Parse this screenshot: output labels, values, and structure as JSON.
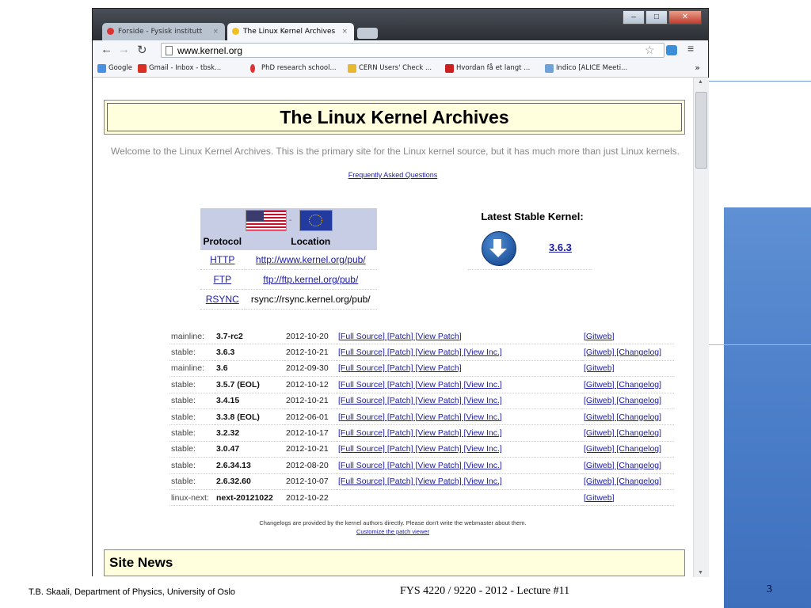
{
  "browser": {
    "tabs": [
      {
        "label": "Forside - Fysisk institutt",
        "active": false
      },
      {
        "label": "The Linux Kernel Archives",
        "active": true
      }
    ],
    "url": "www.kernel.org",
    "bookmarks": [
      "Google",
      "Gmail - Inbox - tbsk...",
      "PhD research school...",
      "CERN Users' Check ...",
      "Hvordan få et langt ...",
      "Indico [ALICE Meeti..."
    ],
    "bookmarks_more": "»"
  },
  "page": {
    "title": "The Linux Kernel Archives",
    "welcome": "Welcome to the Linux Kernel Archives. This is the primary site for the Linux kernel source, but it has much more than just Linux kernels.",
    "faq_link": "Frequently Asked Questions",
    "flag_separator": "-",
    "protocol_table": {
      "headers": [
        "Protocol",
        "Location"
      ],
      "rows": [
        {
          "protocol": "HTTP",
          "location": "http://www.kernel.org/pub/"
        },
        {
          "protocol": "FTP",
          "location": "ftp://ftp.kernel.org/pub/"
        },
        {
          "protocol": "RSYNC",
          "location": "rsync://rsync.kernel.org/pub/"
        }
      ]
    },
    "latest": {
      "title": "Latest Stable Kernel:",
      "version": "3.6.3"
    },
    "releases": [
      {
        "kind": "mainline:",
        "version": "3.7-rc2",
        "date": "2012-10-20",
        "links": "[Full Source] [Patch] [View Patch]",
        "git": "[Gitweb]"
      },
      {
        "kind": "stable:",
        "version": "3.6.3",
        "date": "2012-10-21",
        "links": "[Full Source] [Patch] [View Patch] [View Inc.]",
        "git": "[Gitweb] [Changelog]"
      },
      {
        "kind": "mainline:",
        "version": "3.6",
        "date": "2012-09-30",
        "links": "[Full Source] [Patch] [View Patch]",
        "git": "[Gitweb]"
      },
      {
        "kind": "stable:",
        "version": "3.5.7 (EOL)",
        "date": "2012-10-12",
        "links": "[Full Source] [Patch] [View Patch] [View Inc.]",
        "git": "[Gitweb] [Changelog]"
      },
      {
        "kind": "stable:",
        "version": "3.4.15",
        "date": "2012-10-21",
        "links": "[Full Source] [Patch] [View Patch] [View Inc.]",
        "git": "[Gitweb] [Changelog]"
      },
      {
        "kind": "stable:",
        "version": "3.3.8 (EOL)",
        "date": "2012-06-01",
        "links": "[Full Source] [Patch] [View Patch] [View Inc.]",
        "git": "[Gitweb] [Changelog]"
      },
      {
        "kind": "stable:",
        "version": "3.2.32",
        "date": "2012-10-17",
        "links": "[Full Source] [Patch] [View Patch] [View Inc.]",
        "git": "[Gitweb] [Changelog]"
      },
      {
        "kind": "stable:",
        "version": "3.0.47",
        "date": "2012-10-21",
        "links": "[Full Source] [Patch] [View Patch] [View Inc.]",
        "git": "[Gitweb] [Changelog]"
      },
      {
        "kind": "stable:",
        "version": "2.6.34.13",
        "date": "2012-08-20",
        "links": "[Full Source] [Patch] [View Patch] [View Inc.]",
        "git": "[Gitweb] [Changelog]"
      },
      {
        "kind": "stable:",
        "version": "2.6.32.60",
        "date": "2012-10-07",
        "links": "[Full Source] [Patch] [View Patch] [View Inc.]",
        "git": "[Gitweb] [Changelog]"
      },
      {
        "kind": "linux-next:",
        "version": "next-20121022",
        "date": "2012-10-22",
        "links": "",
        "git": "[Gitweb]"
      }
    ],
    "changelog_note": "Changelogs are provided by the kernel authors directly. Please don't write the webmaster about them.",
    "patch_viewer_link": "Customize the patch viewer",
    "site_news": "Site News"
  },
  "slide": {
    "footer_left": "T.B. Skaali, Department of Physics, University of Oslo",
    "footer_center": "FYS 4220 / 9220 - 2012 -  Lecture #11",
    "page_number": "3"
  }
}
